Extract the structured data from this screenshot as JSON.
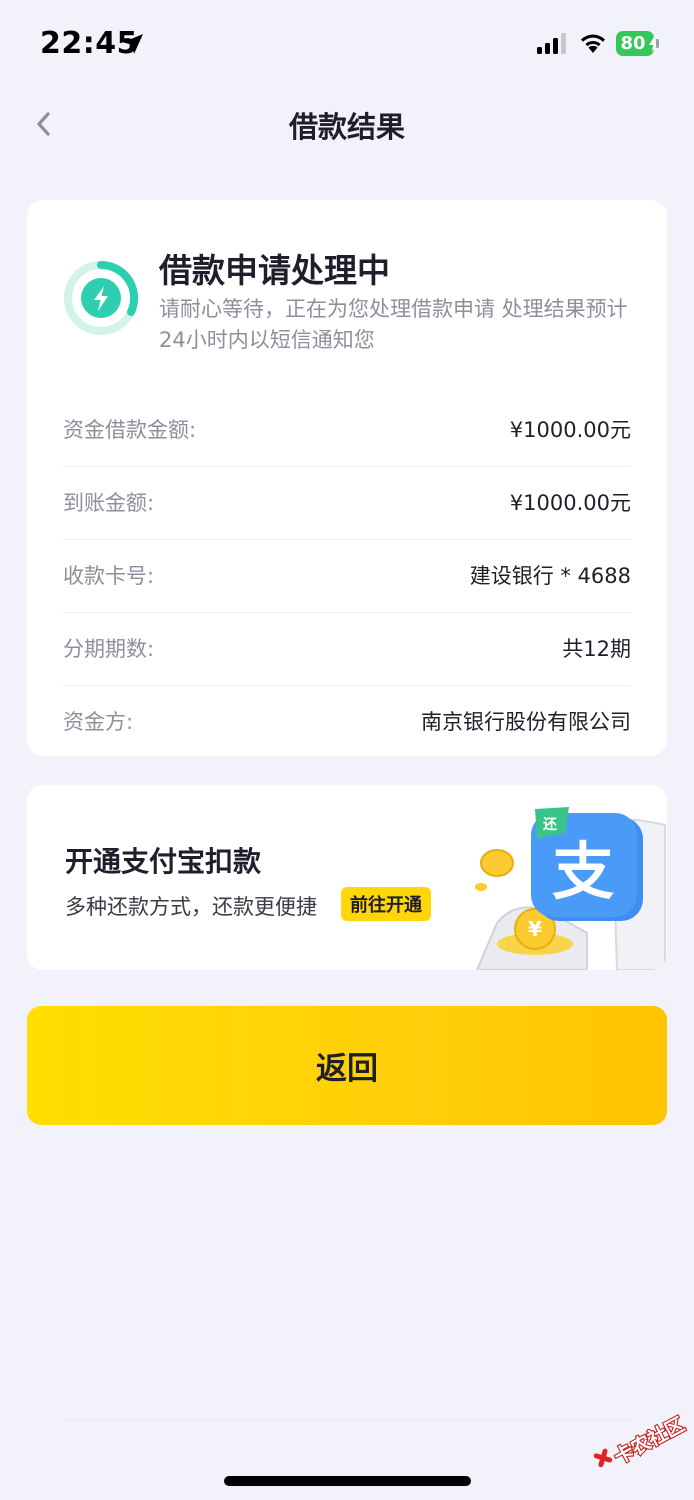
{
  "status_bar": {
    "time": "22:45",
    "battery": "80",
    "icons": [
      "location-arrow-icon",
      "signal-icon",
      "wifi-icon",
      "battery-charging-icon"
    ]
  },
  "nav": {
    "back_icon": "chevron-left-icon",
    "title": "借款结果"
  },
  "status": {
    "icon": "lightning-progress-icon",
    "title": "借款申请处理中",
    "description": "请耐心等待，正在为您处理借款申请 处理结果预计24小时内以短信通知您",
    "items": [
      {
        "label": "资金借款金额:",
        "value": "¥1000.00元"
      },
      {
        "label": "到账金额:",
        "value": "¥1000.00元"
      },
      {
        "label": "收款卡号:",
        "value": "建设银行 * 4688"
      },
      {
        "label": "分期期数:",
        "value": "共12期"
      },
      {
        "label": "资金方:",
        "value": "南京银行股份有限公司"
      }
    ]
  },
  "promo": {
    "title": "开通支付宝扣款",
    "description": "多种还款方式，还款更便捷",
    "button": "前往开通",
    "illustration_glyph": "支",
    "coin_glyph": "¥",
    "tag_glyph": "还"
  },
  "actions": {
    "return_label": "返回"
  },
  "watermark": {
    "text": "卡农社区"
  },
  "colors": {
    "accent_yellow": "#FFD60A",
    "progress_green": "#2DCFB0",
    "background": "#F2F2FA"
  }
}
